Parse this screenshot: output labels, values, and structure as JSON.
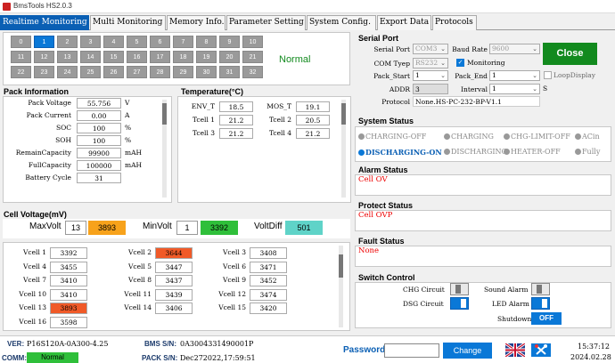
{
  "app": {
    "title": "BmsTools HS2.0.3"
  },
  "tabs": [
    "Realtime Monitoring",
    "Multi Monitoring",
    "Memory Info.",
    "Parameter Setting",
    "System Config.",
    "Export Data",
    "Protocols"
  ],
  "battery_grid": {
    "cells": [
      "0",
      "1",
      "2",
      "3",
      "4",
      "5",
      "6",
      "7",
      "8",
      "9",
      "10",
      "11",
      "12",
      "13",
      "14",
      "15",
      "16",
      "17",
      "18",
      "19",
      "20",
      "21",
      "22",
      "23",
      "24",
      "25",
      "26",
      "27",
      "28",
      "29",
      "30",
      "31",
      "32"
    ],
    "selected": "1",
    "status": "Normal"
  },
  "pack_info": {
    "title": "Pack Information",
    "rows": [
      {
        "label": "Pack Voltage",
        "value": "55.756",
        "unit": "V"
      },
      {
        "label": "Pack Current",
        "value": "0.00",
        "unit": "A"
      },
      {
        "label": "SOC",
        "value": "100",
        "unit": "%"
      },
      {
        "label": "SOH",
        "value": "100",
        "unit": "%"
      },
      {
        "label": "RemainCapacity",
        "value": "99900",
        "unit": "mAH"
      },
      {
        "label": "FullCapacity",
        "value": "100000",
        "unit": "mAH"
      },
      {
        "label": "Battery Cycle",
        "value": "31",
        "unit": ""
      }
    ]
  },
  "temperature": {
    "title": "Temperature(°C)",
    "items": [
      {
        "label": "ENV_T",
        "value": "18.5"
      },
      {
        "label": "MOS_T",
        "value": "19.1"
      },
      {
        "label": "Tcell 1",
        "value": "21.2"
      },
      {
        "label": "Tcell 2",
        "value": "20.5"
      },
      {
        "label": "Tcell 3",
        "value": "21.2"
      },
      {
        "label": "Tcell 4",
        "value": "21.2"
      }
    ]
  },
  "cell_voltage": {
    "title": "Cell Voltage(mV)",
    "max_label": "MaxVolt",
    "max_cell": "13",
    "max_value": "3893",
    "min_label": "MinVolt",
    "min_cell": "1",
    "min_value": "3392",
    "diff_label": "VoltDiff",
    "diff_value": "501",
    "cells": [
      {
        "label": "Vcell 1",
        "value": "3392",
        "highlight": false
      },
      {
        "label": "Vcell 2",
        "value": "3644",
        "highlight": true
      },
      {
        "label": "Vcell 3",
        "value": "3408",
        "highlight": false
      },
      {
        "label": "Vcell 4",
        "value": "3455",
        "highlight": false
      },
      {
        "label": "Vcell 5",
        "value": "3447",
        "highlight": false
      },
      {
        "label": "Vcell 6",
        "value": "3471",
        "highlight": false
      },
      {
        "label": "Vcell 7",
        "value": "3410",
        "highlight": false
      },
      {
        "label": "Vcell 8",
        "value": "3437",
        "highlight": false
      },
      {
        "label": "Vcell 9",
        "value": "3452",
        "highlight": false
      },
      {
        "label": "Vcell 10",
        "value": "3410",
        "highlight": false
      },
      {
        "label": "Vcell 11",
        "value": "3439",
        "highlight": false
      },
      {
        "label": "Vcell 12",
        "value": "3474",
        "highlight": false
      },
      {
        "label": "Vcell 13",
        "value": "3893",
        "highlight": true
      },
      {
        "label": "Vcell 14",
        "value": "3406",
        "highlight": false
      },
      {
        "label": "Vcell 15",
        "value": "3420",
        "highlight": false
      },
      {
        "label": "Vcell 16",
        "value": "3598",
        "highlight": false
      }
    ]
  },
  "serial_port": {
    "title": "Serial Port",
    "port_label": "Serial Port",
    "port_value": "COM3",
    "baud_label": "Baud Rate",
    "baud_value": "9600",
    "close_label": "Close",
    "type_label": "COM Tyep",
    "type_value": "RS232",
    "monitoring_label": "Monitoring",
    "monitoring_checked": true,
    "start_label": "Pack_Start",
    "start_value": "1",
    "end_label": "Pack_End",
    "end_value": "1",
    "loop_label": "LoopDisplay",
    "loop_checked": false,
    "addr_label": "ADDR",
    "addr_value": "3",
    "interval_label": "Interval",
    "interval_value": "1",
    "interval_unit": "S",
    "protocol_label": "Protocol",
    "protocol_value": "None.HS-PC-232-BP-V1.1"
  },
  "system_status": {
    "title": "System Status",
    "items": [
      {
        "label": "CHARGING-OFF",
        "active": false
      },
      {
        "label": "CHARGING",
        "active": false
      },
      {
        "label": "CHG-LIMIT-OFF",
        "active": false
      },
      {
        "label": "ACin",
        "active": false
      },
      {
        "label": "DISCHARGING-ON",
        "active": true
      },
      {
        "label": "DISCHARGING",
        "active": false
      },
      {
        "label": "HEATER-OFF",
        "active": false
      },
      {
        "label": "Fully",
        "active": false
      }
    ]
  },
  "alarm_status": {
    "title": "Alarm Status",
    "value": "Cell OV"
  },
  "protect_status": {
    "title": "Protect Status",
    "value": "Cell OVP"
  },
  "fault_status": {
    "title": "Fault Status",
    "value": "None"
  },
  "switch_control": {
    "title": "Switch Control",
    "chg_label": "CHG Circuit",
    "chg_on": false,
    "sound_label": "Sound Alarm",
    "sound_on": false,
    "dsg_label": "DSG Circuit",
    "dsg_on": true,
    "led_label": "LED Alarm",
    "led_on": true,
    "shutdown_label": "Shutdown",
    "shutdown_value": "OFF"
  },
  "statusbar": {
    "ver_label": "VER:",
    "ver_value": "P16S120A-0A300-4.25",
    "comm_label": "COMM:",
    "comm_value": "Normal",
    "bms_label": "BMS S/N:",
    "bms_value": "0A3004331490001P",
    "pack_label": "PACK S/N:",
    "pack_value": "Dec272022,17:59:51",
    "password_label": "Password",
    "password_value": "",
    "change_label": "Change",
    "time": "15:37:12",
    "date": "2024.02.28"
  },
  "colors": {
    "accent": "#0a78d7",
    "close": "#128a1e",
    "normal_green": "#2fbf3a",
    "max_orange": "#f7a21b",
    "min_green": "#2fbf3a",
    "diff_cyan": "#5fd3c8",
    "cell_red": "#f05a28"
  }
}
